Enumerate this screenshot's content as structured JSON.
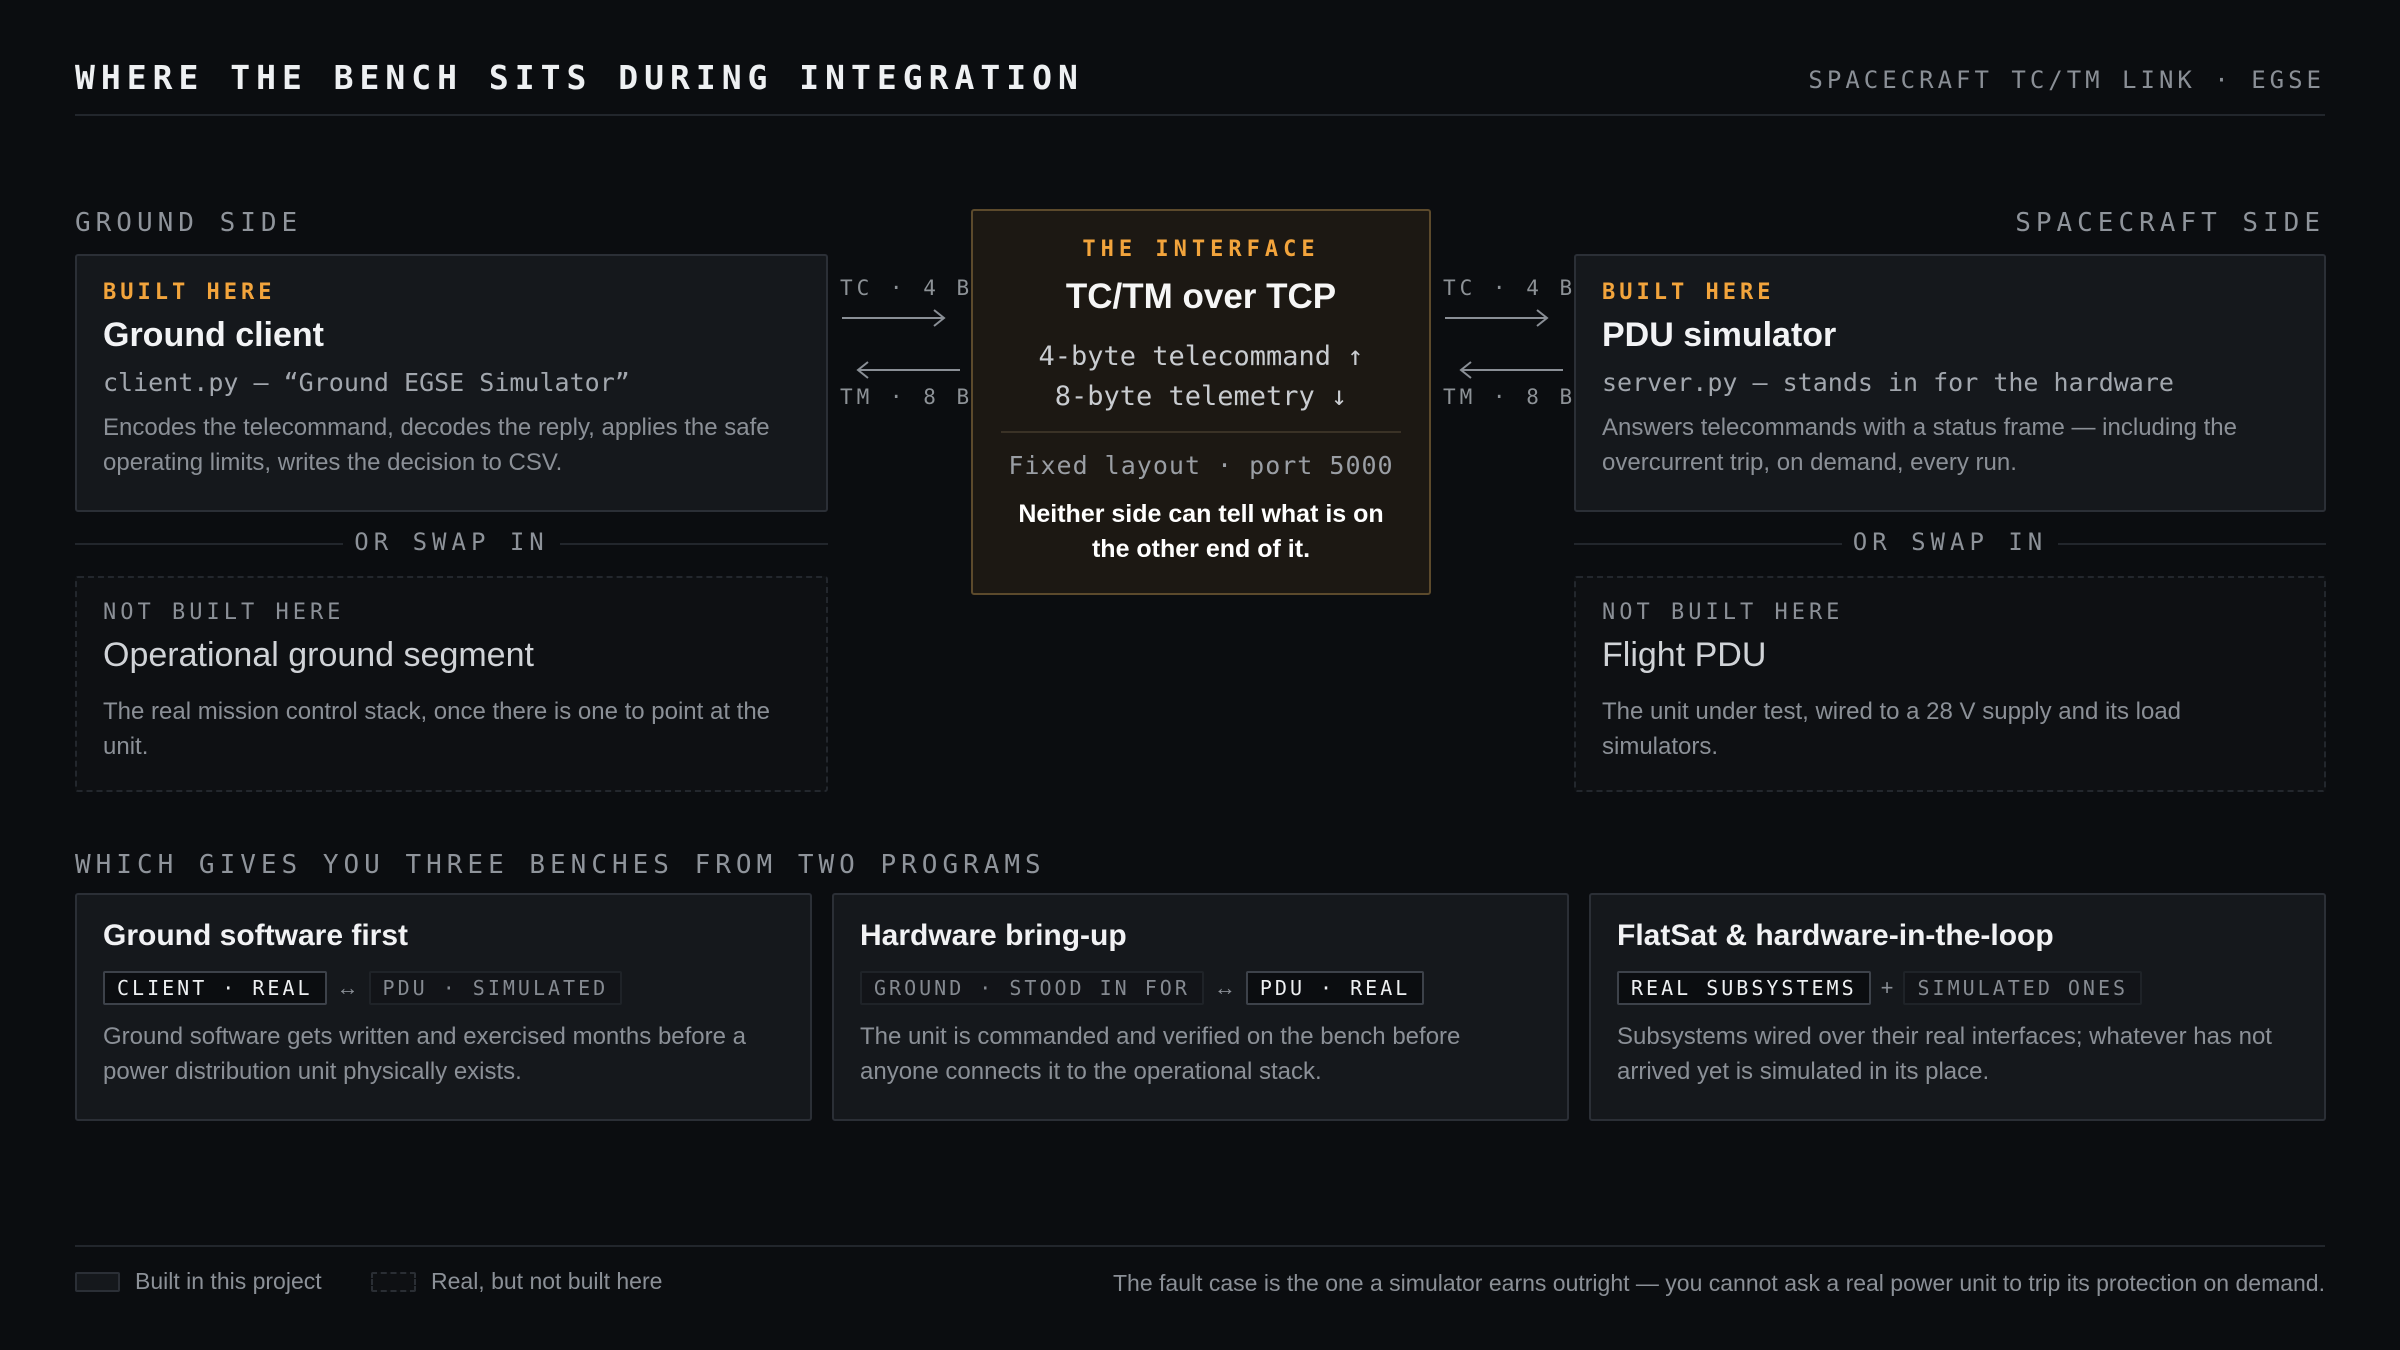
{
  "header": {
    "title": "WHERE THE BENCH SITS DURING INTEGRATION",
    "subtitle": "SPACECRAFT TC/TM LINK · EGSE"
  },
  "ground": {
    "label": "GROUND SIDE",
    "built": {
      "eyebrow": "BUILT HERE",
      "title": "Ground client",
      "sub": "client.py — “Ground EGSE Simulator”",
      "body": "Encodes the telecommand, decodes the reply, applies the safe operating limits, writes the decision to CSV."
    },
    "swap": "OR SWAP IN",
    "notbuilt": {
      "eyebrow": "NOT BUILT HERE",
      "title": "Operational ground segment",
      "body": "The real mission control stack, once there is one to point at the unit."
    }
  },
  "spacecraft": {
    "label": "SPACECRAFT SIDE",
    "built": {
      "eyebrow": "BUILT HERE",
      "title": "PDU simulator",
      "sub": "server.py — stands in for the hardware",
      "body": "Answers telecommands with a status frame — including the overcurrent trip, on demand, every run."
    },
    "swap": "OR SWAP IN",
    "notbuilt": {
      "eyebrow": "NOT BUILT HERE",
      "title": "Flight PDU",
      "body": "The unit under test, wired to a 28 V supply and its load simulators."
    }
  },
  "interface": {
    "eyebrow": "THE INTERFACE",
    "title": "TC/TM over TCP",
    "line1": "4-byte telecommand ↑",
    "line2": "8-byte telemetry ↓",
    "fixed": "Fixed layout · port 5000",
    "note": "Neither side can tell what is on the other end of it."
  },
  "arrows": {
    "tc": "TC · 4 B",
    "tm": "TM · 8 B"
  },
  "benches": {
    "label": "WHICH GIVES YOU THREE BENCHES FROM TWO PROGRAMS",
    "items": [
      {
        "title": "Ground software first",
        "tag1": "CLIENT · REAL",
        "sep": "↔",
        "tag2": "PDU · SIMULATED",
        "body": "Ground software gets written and exercised months before a power distribution unit physically exists."
      },
      {
        "title": "Hardware bring-up",
        "tag1": "GROUND · STOOD IN FOR",
        "sep": "↔",
        "tag2": "PDU · REAL",
        "body": "The unit is commanded and verified on the bench before anyone connects it to the operational stack."
      },
      {
        "title": "FlatSat & hardware-in-the-loop",
        "tag1": "REAL SUBSYSTEMS",
        "sep": "+",
        "tag2": "SIMULATED ONES",
        "body": "Subsystems wired over their real interfaces; whatever has not arrived yet is simulated in its place."
      }
    ]
  },
  "footer": {
    "legend_built": "Built in this project",
    "legend_real": "Real, but not built here",
    "note": "The fault case is the one a simulator earns outright — you cannot ask a real power unit to trip its protection on demand."
  },
  "colors": {
    "accent": "#f2a43c",
    "background": "#0b0d10",
    "card": "#15181c"
  }
}
